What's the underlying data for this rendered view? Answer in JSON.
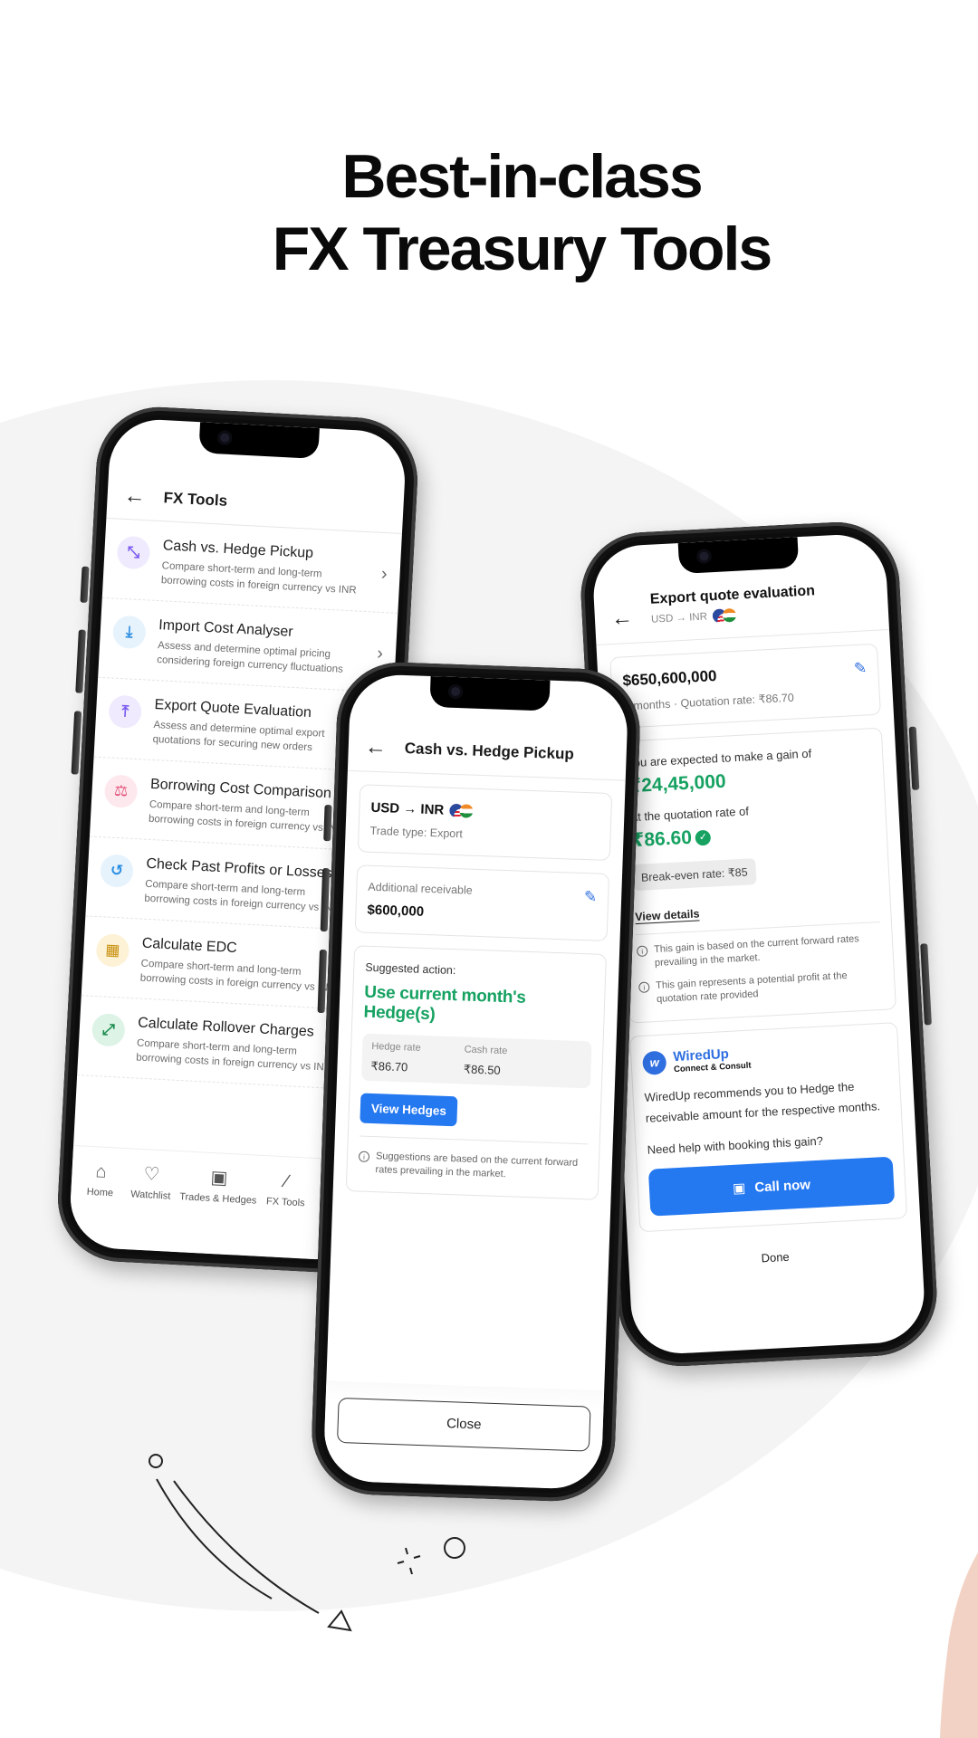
{
  "headline": {
    "line1": "Best-in-class",
    "line2": "FX Treasury Tools"
  },
  "phone_fx_tools": {
    "title": "FX Tools",
    "back_icon": "arrow-left-icon",
    "tools": [
      {
        "title": "Cash vs. Hedge Pickup",
        "desc1": "Compare short-term and long-term",
        "desc2": "borrowing costs in foreign currency vs INR",
        "icon": "swap-arrows-icon",
        "icon_glyph": "⤡",
        "bg": "#efeafd",
        "fg": "#7a5af0"
      },
      {
        "title": "Import Cost Analyser",
        "desc1": "Assess and determine optimal pricing",
        "desc2": "considering foreign currency fluctuations",
        "icon": "download-arrow-icon",
        "icon_glyph": "⤓",
        "bg": "#e6f3fd",
        "fg": "#2b8de0"
      },
      {
        "title": "Export Quote Evaluation",
        "desc1": "Assess and determine optimal export",
        "desc2": "quotations for securing new orders",
        "icon": "upload-arrow-icon",
        "icon_glyph": "⤒",
        "bg": "#efeafd",
        "fg": "#7a5af0"
      },
      {
        "title": "Borrowing Cost Comparison",
        "desc1": "Compare short-term and long-term",
        "desc2": "borrowing costs in foreign currency vs INR",
        "icon": "scales-icon",
        "icon_glyph": "⚖",
        "bg": "#fde8ee",
        "fg": "#e04a72"
      },
      {
        "title": "Check Past Profits or Losses",
        "desc1": "Compare short-term and long-term",
        "desc2": "borrowing costs in foreign currency vs INR",
        "icon": "history-icon",
        "icon_glyph": "↺",
        "bg": "#e6f3fd",
        "fg": "#2b8de0"
      },
      {
        "title": "Calculate EDC",
        "desc1": "Compare short-term and long-term",
        "desc2": "borrowing costs in foreign currency vs INR",
        "icon": "calculator-icon",
        "icon_glyph": "▦",
        "bg": "#fdf1d6",
        "fg": "#c8900e"
      },
      {
        "title": "Calculate Rollover Charges",
        "desc1": "Compare short-term and long-term",
        "desc2": "borrowing costs in foreign currency vs INR",
        "icon": "rollover-arrows-icon",
        "icon_glyph": "⤢",
        "bg": "#dcf3e6",
        "fg": "#1a8c4e"
      }
    ],
    "tabs": [
      {
        "label": "Home",
        "icon": "home-icon",
        "glyph": "⌂"
      },
      {
        "label": "Watchlist",
        "icon": "heart-icon",
        "glyph": "♡"
      },
      {
        "label": "Trades & Hedges",
        "icon": "briefcase-chart-icon",
        "glyph": "▣"
      },
      {
        "label": "FX Tools",
        "icon": "magic-wand-icon",
        "glyph": "⁄"
      }
    ]
  },
  "phone_cash_hedge": {
    "title": "Cash vs. Hedge Pickup",
    "pair": "USD → INR",
    "trade_type": "Trade type: Export",
    "receivable_label": "Additional receivable",
    "receivable_value": "$600,000",
    "suggested_label": "Suggested action:",
    "suggested_action": "Use current month's Hedge(s)",
    "hedge_rate_label": "Hedge rate",
    "hedge_rate": "₹86.70",
    "cash_rate_label": "Cash rate",
    "cash_rate": "₹86.50",
    "view_hedges": "View Hedges",
    "note": "Suggestions are based on the current forward rates prevailing in the market.",
    "close": "Close"
  },
  "phone_export_quote": {
    "title": "Export quote evaluation",
    "pair": "USD → INR",
    "amount": "$650,600,000",
    "terms": "3 months · Quotation rate: ₹86.70",
    "gain_label": "You are expected to make a gain of",
    "gain_value": "₹24,45,000",
    "rate_label": "At the quotation rate of",
    "rate_value": "₹86.60",
    "break_even": "Break-even rate: ₹85",
    "view_details": "View details",
    "note1": "This gain is based on the current forward rates prevailing in the market.",
    "note2": "This gain represents a potential profit at the quotation rate provided",
    "brand_name": "WiredUp",
    "brand_tagline": "Connect & Consult",
    "recommendation": "WiredUp recommends you to Hedge the receivable amount for the respective months.",
    "help": "Need help with booking this gain?",
    "call_now": "Call now",
    "done": "Done"
  },
  "colors": {
    "green": "#17a262",
    "blue": "#2478f0",
    "brand_blue": "#2f6fe0"
  }
}
